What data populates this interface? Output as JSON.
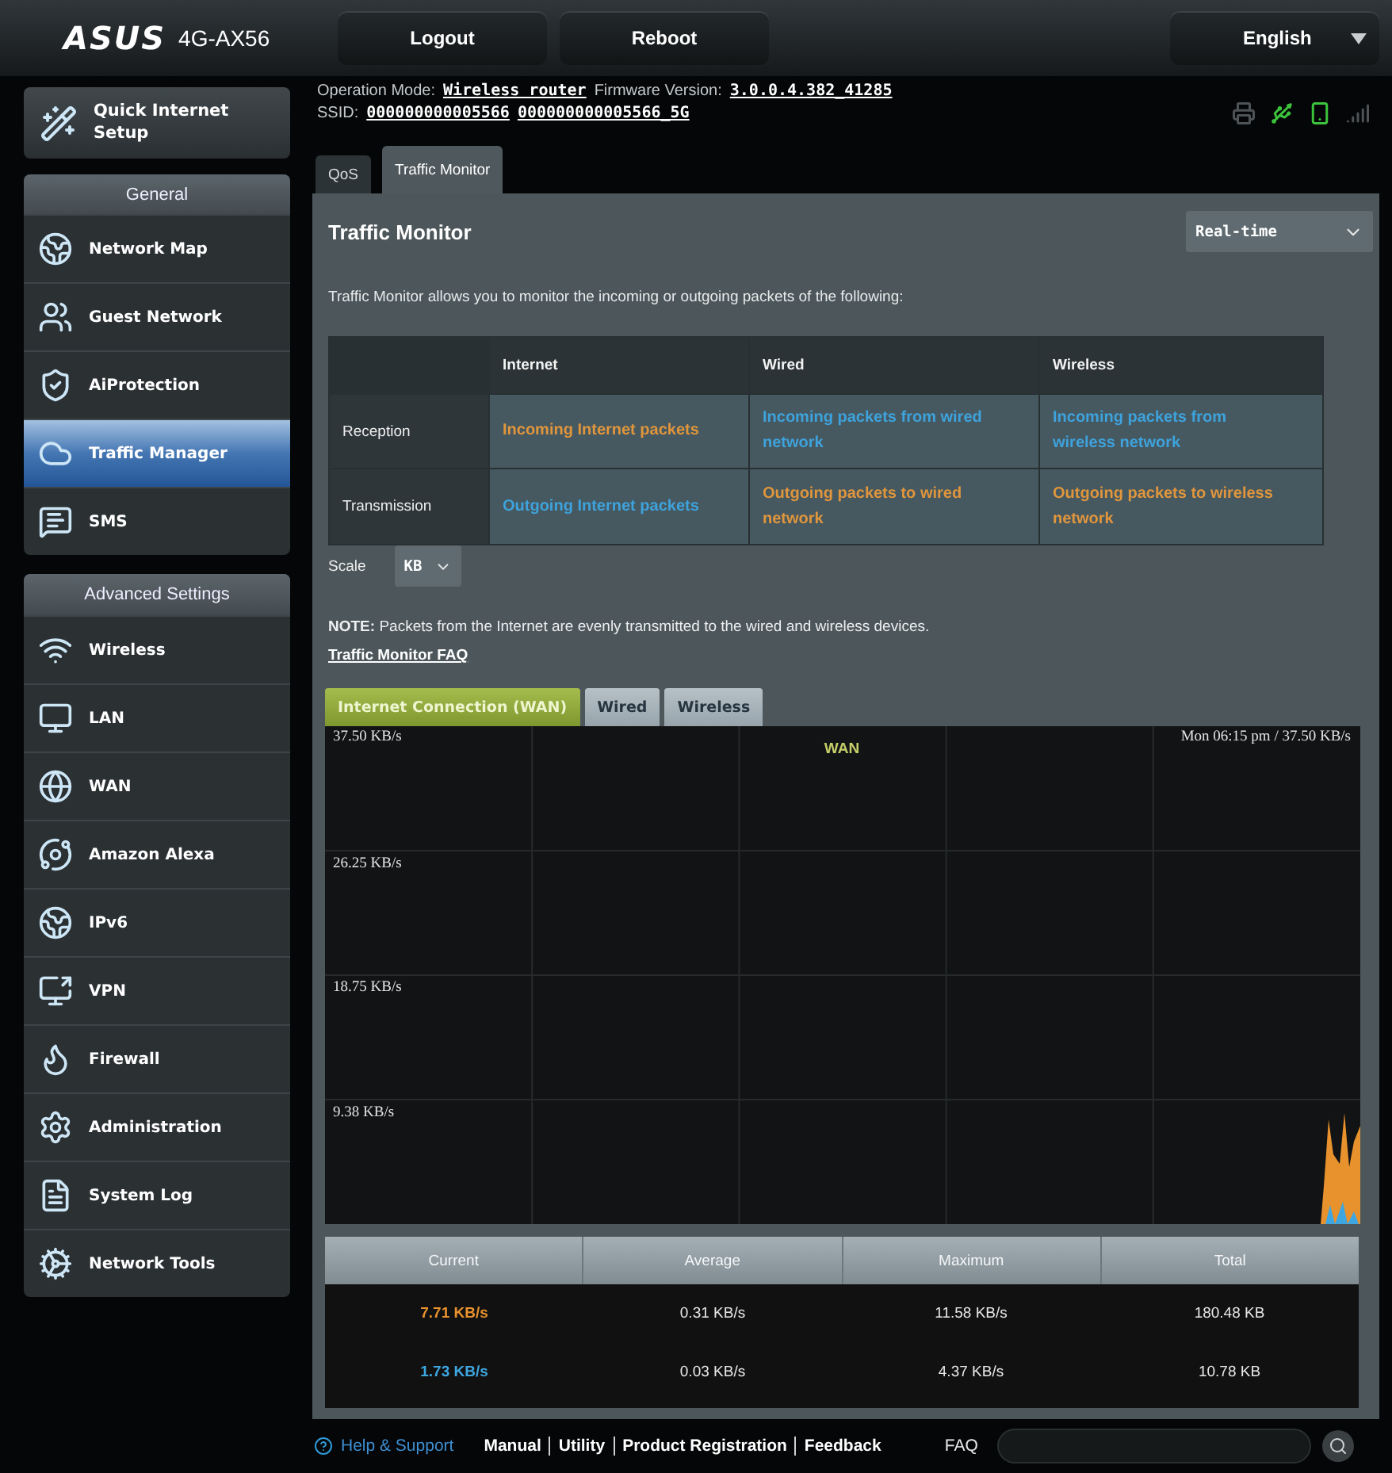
{
  "header": {
    "logo": "ASUS",
    "model": "4G-AX56",
    "buttons": [
      "Logout",
      "Reboot"
    ],
    "language": "English"
  },
  "sidebar": {
    "quick_setup": "Quick Internet Setup",
    "groups": [
      {
        "title": "General",
        "items": [
          {
            "label": "Network Map",
            "selected": false
          },
          {
            "label": "Guest Network",
            "selected": false
          },
          {
            "label": "AiProtection",
            "selected": false
          },
          {
            "label": "Traffic Manager",
            "selected": true
          },
          {
            "label": "SMS",
            "selected": false
          }
        ]
      },
      {
        "title": "Advanced Settings",
        "items": [
          {
            "label": "Wireless",
            "selected": false
          },
          {
            "label": "LAN",
            "selected": false
          },
          {
            "label": "WAN",
            "selected": false
          },
          {
            "label": "Amazon Alexa",
            "selected": false
          },
          {
            "label": "IPv6",
            "selected": false
          },
          {
            "label": "VPN",
            "selected": false
          },
          {
            "label": "Firewall",
            "selected": false
          },
          {
            "label": "Administration",
            "selected": false
          },
          {
            "label": "System Log",
            "selected": false
          },
          {
            "label": "Network Tools",
            "selected": false
          }
        ]
      }
    ]
  },
  "status": {
    "operation_mode_label": "Operation Mode:",
    "operation_mode": "Wireless router",
    "firmware_label": "Firmware Version:",
    "firmware": "3.0.0.4.382_41285",
    "ssid_label": "SSID:",
    "ssids": [
      "000000000005566",
      "000000000005566_5G"
    ],
    "indicators": [
      {
        "active": false
      },
      {
        "active": true
      },
      {
        "active": true
      },
      {
        "active": false
      }
    ]
  },
  "tabs": [
    {
      "label": "QoS",
      "selected": false
    },
    {
      "label": "Traffic Monitor",
      "selected": true
    }
  ],
  "panel": {
    "title": "Traffic Monitor",
    "period": "Real-time",
    "description": "Traffic Monitor allows you to monitor the incoming or outgoing packets of the following:",
    "table": {
      "columns": [
        "Internet",
        "Wired",
        "Wireless"
      ],
      "rows": [
        {
          "label": "Reception",
          "cells": [
            {
              "text": "Incoming Internet packets",
              "color": "#e0963c"
            },
            {
              "text": "Incoming packets from wired network",
              "color": "#3ea3dc"
            },
            {
              "text": "Incoming packets from wireless network",
              "color": "#3ea3dc"
            }
          ]
        },
        {
          "label": "Transmission",
          "cells": [
            {
              "text": "Outgoing Internet packets",
              "color": "#3ea3dc"
            },
            {
              "text": "Outgoing packets to wired network",
              "color": "#e0963c"
            },
            {
              "text": "Outgoing packets to wireless network",
              "color": "#e0963c"
            }
          ]
        }
      ]
    },
    "scale": {
      "label": "Scale",
      "value": "KB"
    },
    "note": "**NOTE:** Packets from the Internet are evenly transmitted to the wired and wireless devices.",
    "faq_link": "Traffic Monitor FAQ"
  },
  "chart_tabs": [
    {
      "label": "Internet Connection (WAN)",
      "selected": true
    },
    {
      "label": "Wired",
      "selected": false
    },
    {
      "label": "Wireless",
      "selected": false
    }
  ],
  "graph": {
    "title": "WAN",
    "readout": "Mon 06:15 pm / 37.50 KB/s",
    "y_labels": [
      "37.50 KB/s",
      "26.25 KB/s",
      "18.75 KB/s",
      "9.38 KB/s"
    ]
  },
  "stats": {
    "columns": [
      "Current",
      "Average",
      "Maximum",
      "Total"
    ],
    "rows": [
      {
        "color": "#e8922e",
        "values": [
          "7.71 KB/s",
          "0.31 KB/s",
          "11.58 KB/s",
          "180.48 KB"
        ]
      },
      {
        "color": "#3ea6e0",
        "values": [
          "1.73 KB/s",
          "0.03 KB/s",
          "4.37 KB/s",
          "10.78 KB"
        ]
      }
    ]
  },
  "footer": {
    "help": "Help & Support",
    "links": [
      "Manual",
      "Utility",
      "Product Registration",
      "Feedback"
    ],
    "faq": "FAQ"
  }
}
